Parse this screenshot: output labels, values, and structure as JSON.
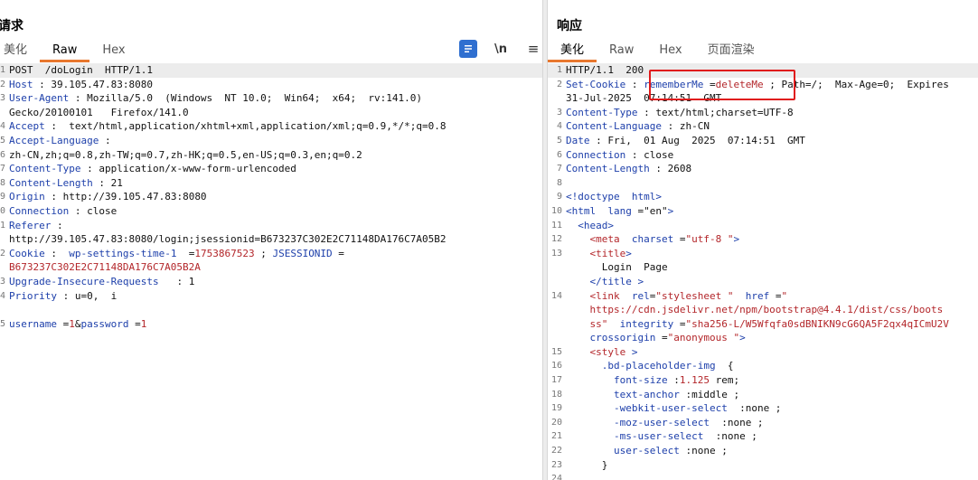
{
  "request": {
    "title": "请求",
    "tabs": [
      "美化",
      "Raw",
      "Hex"
    ],
    "active_tab": 1,
    "toolbar": {
      "newline_label": "\\n",
      "menu_label": "≡"
    },
    "lines": [
      {
        "n": "1",
        "parts": [
          {
            "c": "v",
            "t": "POST  /doLogin  HTTP/1.1"
          }
        ]
      },
      {
        "n": "2",
        "parts": [
          {
            "c": "k",
            "t": "Host"
          },
          {
            "c": "v",
            "t": " : 39.105.47.83:8080"
          }
        ]
      },
      {
        "n": "3",
        "parts": [
          {
            "c": "k",
            "t": "User-Agent"
          },
          {
            "c": "v",
            "t": " : Mozilla/5.0  (Windows  NT 10.0;  Win64;  x64;  rv:141.0)"
          }
        ]
      },
      {
        "n": "",
        "parts": [
          {
            "c": "v",
            "t": "Gecko/20100101   Firefox/141.0"
          }
        ]
      },
      {
        "n": "4",
        "parts": [
          {
            "c": "k",
            "t": "Accept"
          },
          {
            "c": "v",
            "t": " :  text/html,application/xhtml+xml,application/xml;q=0.9,*/*;q=0.8"
          }
        ]
      },
      {
        "n": "5",
        "parts": [
          {
            "c": "k",
            "t": "Accept-Language"
          },
          {
            "c": "v",
            "t": " :"
          }
        ]
      },
      {
        "n": "6",
        "parts": [
          {
            "c": "v",
            "t": "zh-CN,zh;q=0.8,zh-TW;q=0.7,zh-HK;q=0.5,en-US;q=0.3,en;q=0.2"
          }
        ]
      },
      {
        "n": "7",
        "parts": [
          {
            "c": "k",
            "t": "Content-Type"
          },
          {
            "c": "v",
            "t": " : application/x-www-form-urlencoded"
          }
        ]
      },
      {
        "n": "8",
        "parts": [
          {
            "c": "k",
            "t": "Content-Length"
          },
          {
            "c": "v",
            "t": " : 21"
          }
        ]
      },
      {
        "n": "9",
        "parts": [
          {
            "c": "k",
            "t": "Origin"
          },
          {
            "c": "v",
            "t": " : http://39.105.47.83:8080"
          }
        ]
      },
      {
        "n": "0",
        "parts": [
          {
            "c": "k",
            "t": "Connection"
          },
          {
            "c": "v",
            "t": " : close"
          }
        ]
      },
      {
        "n": "1",
        "parts": [
          {
            "c": "k",
            "t": "Referer"
          },
          {
            "c": "v",
            "t": " :"
          }
        ]
      },
      {
        "n": "",
        "parts": [
          {
            "c": "v",
            "t": "http://39.105.47.83:8080/login;jsessionid=B673237C302E2C71148DA176C7A05B2"
          }
        ]
      },
      {
        "n": "2",
        "parts": [
          {
            "c": "k",
            "t": "Cookie"
          },
          {
            "c": "v",
            "t": " :  "
          },
          {
            "c": "k",
            "t": "wp-settings-time-1"
          },
          {
            "c": "v",
            "t": "  ="
          },
          {
            "c": "red",
            "t": "1753867523"
          },
          {
            "c": "v",
            "t": " ; "
          },
          {
            "c": "k",
            "t": "JSESSIONID"
          },
          {
            "c": "v",
            "t": " ="
          }
        ]
      },
      {
        "n": "",
        "parts": [
          {
            "c": "red",
            "t": "B673237C302E2C71148DA176C7A05B2A"
          }
        ]
      },
      {
        "n": "3",
        "parts": [
          {
            "c": "k",
            "t": "Upgrade-Insecure-Requests"
          },
          {
            "c": "v",
            "t": "   : 1"
          }
        ]
      },
      {
        "n": "4",
        "parts": [
          {
            "c": "k",
            "t": "Priority"
          },
          {
            "c": "v",
            "t": " : u=0,  i"
          }
        ]
      },
      {
        "n": "",
        "parts": []
      },
      {
        "n": "5",
        "parts": [
          {
            "c": "blue",
            "t": "username"
          },
          {
            "c": "v",
            "t": " ="
          },
          {
            "c": "red",
            "t": "1"
          },
          {
            "c": "v",
            "t": "&"
          },
          {
            "c": "blue",
            "t": "password"
          },
          {
            "c": "v",
            "t": " ="
          },
          {
            "c": "red",
            "t": "1"
          }
        ]
      }
    ]
  },
  "response": {
    "title": "响应",
    "tabs": [
      "美化",
      "Raw",
      "Hex",
      "页面渲染"
    ],
    "active_tab": 0,
    "lines": [
      {
        "n": "1",
        "parts": [
          {
            "c": "v",
            "t": "HTTP/1.1  200"
          }
        ]
      },
      {
        "n": "2",
        "parts": [
          {
            "c": "k",
            "t": "Set-Cookie"
          },
          {
            "c": "v",
            "t": " : "
          },
          {
            "c": "k",
            "t": "rememberMe"
          },
          {
            "c": "v",
            "t": " ="
          },
          {
            "c": "red",
            "t": "deleteMe"
          },
          {
            "c": "v",
            "t": " ; Path=/;  Max-Age=0;  Expires"
          }
        ]
      },
      {
        "n": "",
        "parts": [
          {
            "c": "v",
            "t": "31-Jul-2025  07:14:51  GMT"
          }
        ]
      },
      {
        "n": "3",
        "parts": [
          {
            "c": "k",
            "t": "Content-Type"
          },
          {
            "c": "v",
            "t": " : text/html;charset=UTF-8"
          }
        ]
      },
      {
        "n": "4",
        "parts": [
          {
            "c": "k",
            "t": "Content-Language"
          },
          {
            "c": "v",
            "t": " : zh-CN"
          }
        ]
      },
      {
        "n": "5",
        "parts": [
          {
            "c": "k",
            "t": "Date"
          },
          {
            "c": "v",
            "t": " : Fri,  01 Aug  2025  07:14:51  GMT"
          }
        ]
      },
      {
        "n": "6",
        "parts": [
          {
            "c": "k",
            "t": "Connection"
          },
          {
            "c": "v",
            "t": " : close"
          }
        ]
      },
      {
        "n": "7",
        "parts": [
          {
            "c": "k",
            "t": "Content-Length"
          },
          {
            "c": "v",
            "t": " : 2608"
          }
        ]
      },
      {
        "n": "8",
        "parts": []
      },
      {
        "n": "9",
        "parts": [
          {
            "c": "blue",
            "t": "<!doctype  html>"
          }
        ]
      },
      {
        "n": "10",
        "parts": [
          {
            "c": "blue",
            "t": "<html  lang"
          },
          {
            "c": "v",
            "t": " ="
          },
          {
            "c": "v",
            "t": "\"en\""
          },
          {
            "c": "blue",
            "t": ">"
          }
        ]
      },
      {
        "n": "11",
        "parts": [
          {
            "c": "v",
            "t": "  "
          },
          {
            "c": "blue",
            "t": "<head"
          },
          {
            "c": "blue",
            "t": ">"
          }
        ]
      },
      {
        "n": "12",
        "parts": [
          {
            "c": "v",
            "t": "    "
          },
          {
            "c": "red",
            "t": "<meta"
          },
          {
            "c": "v",
            "t": "  "
          },
          {
            "c": "blue",
            "t": "charset"
          },
          {
            "c": "v",
            "t": " ="
          },
          {
            "c": "red",
            "t": "\"utf-8 \""
          },
          {
            "c": "blue",
            "t": ">"
          }
        ]
      },
      {
        "n": "13",
        "parts": [
          {
            "c": "v",
            "t": "    "
          },
          {
            "c": "red",
            "t": "<title"
          },
          {
            "c": "blue",
            "t": ">"
          }
        ]
      },
      {
        "n": "",
        "parts": [
          {
            "c": "v",
            "t": "      Login  Page"
          }
        ]
      },
      {
        "n": "",
        "parts": [
          {
            "c": "v",
            "t": "    "
          },
          {
            "c": "blue",
            "t": "</title"
          },
          {
            "c": "blue",
            "t": " >"
          }
        ]
      },
      {
        "n": "14",
        "parts": [
          {
            "c": "v",
            "t": "    "
          },
          {
            "c": "red",
            "t": "<link"
          },
          {
            "c": "v",
            "t": "  "
          },
          {
            "c": "blue",
            "t": "rel"
          },
          {
            "c": "v",
            "t": "="
          },
          {
            "c": "red",
            "t": "\"stylesheet \""
          },
          {
            "c": "v",
            "t": "  "
          },
          {
            "c": "blue",
            "t": "href"
          },
          {
            "c": "v",
            "t": " ="
          },
          {
            "c": "red",
            "t": "\""
          }
        ]
      },
      {
        "n": "",
        "parts": [
          {
            "c": "v",
            "t": "    "
          },
          {
            "c": "red",
            "t": "https://cdn.jsdelivr.net/npm/bootstrap@4.4.1/dist/css/boots"
          }
        ]
      },
      {
        "n": "",
        "parts": [
          {
            "c": "v",
            "t": "    "
          },
          {
            "c": "red",
            "t": "ss\""
          },
          {
            "c": "v",
            "t": "  "
          },
          {
            "c": "blue",
            "t": "integrity"
          },
          {
            "c": "v",
            "t": " ="
          },
          {
            "c": "red",
            "t": "\"sha256-L/W5Wfqfa0sdBNIKN9cG6QA5F2qx4qICmU2V"
          }
        ]
      },
      {
        "n": "",
        "parts": [
          {
            "c": "v",
            "t": "    "
          },
          {
            "c": "blue",
            "t": "crossorigin"
          },
          {
            "c": "v",
            "t": " ="
          },
          {
            "c": "red",
            "t": "\"anonymous \""
          },
          {
            "c": "blue",
            "t": ">"
          }
        ]
      },
      {
        "n": "15",
        "parts": [
          {
            "c": "v",
            "t": "    "
          },
          {
            "c": "red",
            "t": "<style"
          },
          {
            "c": "blue",
            "t": " >"
          }
        ]
      },
      {
        "n": "16",
        "parts": [
          {
            "c": "v",
            "t": "      "
          },
          {
            "c": "blue",
            "t": ".bd-placeholder-img"
          },
          {
            "c": "v",
            "t": "  {"
          }
        ]
      },
      {
        "n": "17",
        "parts": [
          {
            "c": "v",
            "t": "        "
          },
          {
            "c": "blue",
            "t": "font-size"
          },
          {
            "c": "v",
            "t": " :"
          },
          {
            "c": "red",
            "t": "1.125"
          },
          {
            "c": "v",
            "t": " rem;"
          }
        ]
      },
      {
        "n": "18",
        "parts": [
          {
            "c": "v",
            "t": "        "
          },
          {
            "c": "blue",
            "t": "text-anchor"
          },
          {
            "c": "v",
            "t": " :middle ;"
          }
        ]
      },
      {
        "n": "19",
        "parts": [
          {
            "c": "v",
            "t": "        "
          },
          {
            "c": "blue",
            "t": "-webkit-user-select"
          },
          {
            "c": "v",
            "t": "  :none ;"
          }
        ]
      },
      {
        "n": "20",
        "parts": [
          {
            "c": "v",
            "t": "        "
          },
          {
            "c": "blue",
            "t": "-moz-user-select"
          },
          {
            "c": "v",
            "t": "  :none ;"
          }
        ]
      },
      {
        "n": "21",
        "parts": [
          {
            "c": "v",
            "t": "        "
          },
          {
            "c": "blue",
            "t": "-ms-user-select"
          },
          {
            "c": "v",
            "t": "  :none ;"
          }
        ]
      },
      {
        "n": "22",
        "parts": [
          {
            "c": "v",
            "t": "        "
          },
          {
            "c": "blue",
            "t": "user-select"
          },
          {
            "c": "v",
            "t": " :none ;"
          }
        ]
      },
      {
        "n": "23",
        "parts": [
          {
            "c": "v",
            "t": "      }"
          }
        ]
      },
      {
        "n": "24",
        "parts": []
      }
    ]
  },
  "colors": {
    "accent_tab": "#e8772e",
    "highlight_box": "#e0191b",
    "keyword": "#1d3faa",
    "value": "#b3262a"
  }
}
